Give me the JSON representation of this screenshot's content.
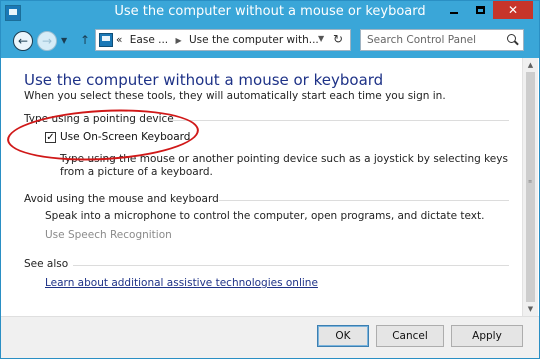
{
  "window": {
    "title": "Use the computer without a mouse or keyboard",
    "title_bar_color": "#3aa6d8",
    "close_color": "#c7352a"
  },
  "toolbar": {
    "back_icon": "back-arrow-icon",
    "forward_icon": "forward-arrow-icon",
    "recent_icon": "chevron-down-icon",
    "up_icon": "up-arrow-icon",
    "address": {
      "overflow": "«",
      "crumbs": [
        "Ease ...",
        "Use the computer with..."
      ]
    },
    "refresh_icon": "refresh-icon",
    "search_placeholder": "Search Control Panel"
  },
  "main": {
    "heading": "Use the computer without a mouse or keyboard",
    "subtitle": "When you select these tools, they will automatically start each time you sign in.",
    "groups": [
      {
        "header": "Type using a pointing device",
        "option_label": "Use On-Screen Keyboard",
        "option_checked": true,
        "description": "Type using the mouse or another pointing device such as a joystick by selecting keys from a picture of a keyboard."
      },
      {
        "header": "Avoid using the mouse and keyboard",
        "description": "Speak into a microphone to control the computer, open programs, and dictate text.",
        "option_label": "Use Speech Recognition"
      }
    ],
    "see_also": {
      "header": "See also",
      "link": "Learn about additional assistive technologies online"
    },
    "annotation_color": "#d01818"
  },
  "footer": {
    "ok": "OK",
    "cancel": "Cancel",
    "apply": "Apply"
  }
}
